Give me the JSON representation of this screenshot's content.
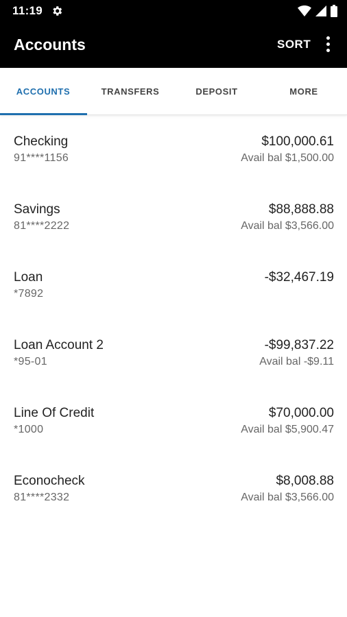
{
  "status_bar": {
    "time": "11:19",
    "icons": [
      "settings-icon",
      "wifi-icon",
      "signal-icon",
      "battery-icon"
    ]
  },
  "app_bar": {
    "title": "Accounts",
    "sort_label": "SORT",
    "menu_icon": "more-vert-icon"
  },
  "tabs": [
    {
      "label": "ACCOUNTS",
      "active": true
    },
    {
      "label": "TRANSFERS",
      "active": false
    },
    {
      "label": "DEPOSIT",
      "active": false
    },
    {
      "label": "MORE",
      "active": false
    }
  ],
  "accounts": [
    {
      "name": "Checking",
      "number": "91****1156",
      "balance": "$100,000.61",
      "available": "Avail bal $1,500.00"
    },
    {
      "name": "Savings",
      "number": "81****2222",
      "balance": "$88,888.88",
      "available": "Avail bal $3,566.00"
    },
    {
      "name": "Loan",
      "number": "*7892",
      "balance": "-$32,467.19",
      "available": ""
    },
    {
      "name": "Loan Account 2",
      "number": "*95-01",
      "balance": "-$99,837.22",
      "available": "Avail bal -$9.11"
    },
    {
      "name": "Line Of Credit",
      "number": "*1000",
      "balance": "$70,000.00",
      "available": "Avail bal $5,900.47"
    },
    {
      "name": "Econocheck",
      "number": "81****2332",
      "balance": "$8,008.88",
      "available": "Avail bal $3,566.00"
    }
  ],
  "colors": {
    "app_bar": "#000000",
    "accent": "#1f6fae",
    "primary_text": "#222222",
    "secondary_text": "#666666"
  }
}
